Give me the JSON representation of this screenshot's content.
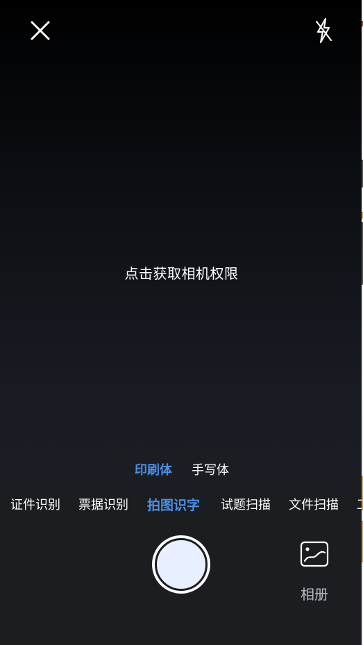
{
  "camera": {
    "permission_prompt": "点击获取相机权限"
  },
  "icons": {
    "close": "close-icon",
    "flash": "flash-off-icon",
    "album": "gallery-icon"
  },
  "submode": {
    "items": [
      {
        "label": "印刷体",
        "active": true
      },
      {
        "label": "手写体",
        "active": false
      }
    ]
  },
  "modes": {
    "items": [
      {
        "label": "证件识别",
        "active": false
      },
      {
        "label": "票据识别",
        "active": false
      },
      {
        "label": "拍图识字",
        "active": true
      },
      {
        "label": "试题扫描",
        "active": false
      },
      {
        "label": "文件扫描",
        "active": false
      },
      {
        "label": "工",
        "active": false
      }
    ]
  },
  "album": {
    "label": "相册"
  },
  "colors": {
    "accent": "#4a8fe9",
    "panel": "#1b1d21",
    "text": "#ffffff"
  }
}
